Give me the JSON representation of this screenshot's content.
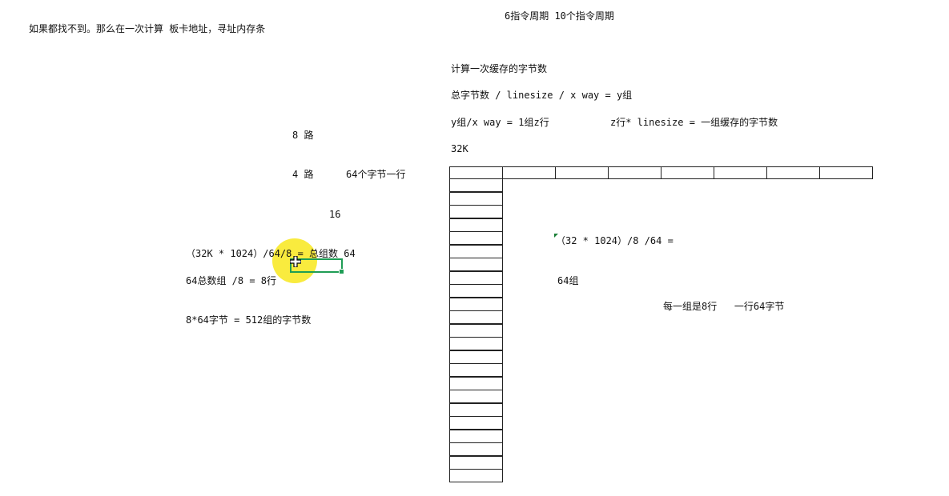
{
  "colors": {
    "highlight": "#f8e71c",
    "selection": "#1f9d55",
    "comment_marker": "#1a7f37",
    "grid_line": "#222222"
  },
  "notes": {
    "header_left": "如果都找不到。那么在一次计算 板卡地址，寻址内存条",
    "header_center": "6指令周期 10个指令周期",
    "ways_8": "8 路",
    "ways_4": "4 路",
    "bytes_per_line": "64个字节一行",
    "sixteen": "16",
    "formula_groups": "（32K * 1024）/64/8 = 总组数 64",
    "total_groups_rows": "64总数组 /8 = 8行",
    "group_bytes": "8*64字节 = 512组的字节数",
    "calc_title": "计算一次缓存的字节数",
    "formula_total": "总字节数 / linesize / x way = y组",
    "formula_y": "y组/x way = 1组z行",
    "formula_z": "z行* linesize = 一组缓存的字节数",
    "size_32k": "32K",
    "formula_32": "（32 * 1024）/8 /64 =",
    "groups_64": "64组",
    "group_summary": "每一组是8行   一行64字节"
  },
  "grid": {
    "top_row_cells": 8,
    "column_cells": 23
  },
  "icons": {
    "cursor": "cell-select-cursor-icon",
    "comment": "comment-indicator-icon"
  }
}
